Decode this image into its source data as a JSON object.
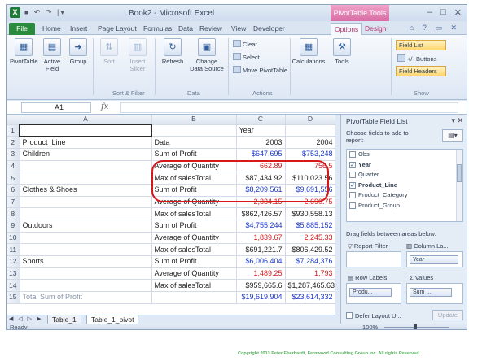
{
  "window": {
    "title": "Book2 - Microsoft Excel",
    "context_title": "PivotTable Tools",
    "app_icon": "excel-icon",
    "qat": "■ ↶ ↷ |▾",
    "controls": [
      "–",
      "□",
      "✕"
    ]
  },
  "tabs": [
    "File",
    "Home",
    "Insert",
    "Page Layout",
    "Formulas",
    "Data",
    "Review",
    "View",
    "Developer",
    "Options",
    "Design"
  ],
  "help_icons": "⌂ ? ▭ ✕",
  "ribbon": {
    "pivottable": "PivotTable",
    "active_field": "Active Field",
    "group": "Group",
    "sort": "Sort",
    "insert_slicer": "Insert Slicer",
    "refresh": "Refresh",
    "change_data_source": "Change Data Source",
    "clear": "Clear",
    "select": "Select",
    "move_pivottable": "Move PivotTable",
    "calculations": "Calculations",
    "tools": "Tools",
    "field_list": "Field List",
    "buttons": "+/- Buttons",
    "field_headers": "Field Headers",
    "groups": [
      "Sort & Filter",
      "Data",
      "Actions",
      "Show"
    ]
  },
  "formula_bar": {
    "cell_ref": "A1",
    "fx": "fx",
    "value": ""
  },
  "sheet": {
    "col_headers": [
      "A",
      "B",
      "C",
      "D"
    ],
    "rows": [
      {
        "rn": "1",
        "a": "",
        "b": "",
        "c": "Year",
        "d": ""
      },
      {
        "rn": "2",
        "a": "Product_Line",
        "b": "Data",
        "c": "2003",
        "d": "2004"
      },
      {
        "rn": "3",
        "a": "Children",
        "b": "Sum of Profit",
        "c": "$647,695",
        "d": "$753,248"
      },
      {
        "rn": "4",
        "a": "",
        "b": "Average of Quantity",
        "c": "662.89",
        "d": "756.5"
      },
      {
        "rn": "5",
        "a": "",
        "b": "Max of salesTotal",
        "c": "$87,434.92",
        "d": "$110,023.56"
      },
      {
        "rn": "6",
        "a": "Clothes & Shoes",
        "b": "Sum of Profit",
        "c": "$8,209,561",
        "d": "$9,691,556"
      },
      {
        "rn": "7",
        "a": "",
        "b": "Average of Quantity",
        "c": "2,334.15",
        "d": "2,690.75"
      },
      {
        "rn": "8",
        "a": "",
        "b": "Max of salesTotal",
        "c": "$862,426.57",
        "d": "$930,558.13"
      },
      {
        "rn": "9",
        "a": "Outdoors",
        "b": "Sum of Profit",
        "c": "$4,755,244",
        "d": "$5,885,152"
      },
      {
        "rn": "10",
        "a": "",
        "b": "Average of Quantity",
        "c": "1,839.67",
        "d": "2,245.33"
      },
      {
        "rn": "11",
        "a": "",
        "b": "Max of salesTotal",
        "c": "$691,221.7",
        "d": "$806,429.52"
      },
      {
        "rn": "12",
        "a": "Sports",
        "b": "Sum of Profit",
        "c": "$6,006,404",
        "d": "$7,284,376"
      },
      {
        "rn": "13",
        "a": "",
        "b": "Average of Quantity",
        "c": "1,489.25",
        "d": "1,793"
      },
      {
        "rn": "14",
        "a": "",
        "b": "Max of salesTotal",
        "c": "$959,665.6",
        "d": "$1,287,465.63"
      },
      {
        "rn": "15",
        "a": "Total Sum of Profit",
        "b": "",
        "c": "$19,619,904",
        "d": "$23,614,332"
      }
    ],
    "tabs": [
      "Table_1",
      "Table_1_pivot"
    ],
    "nav_arrows": "◀ ◁ ▷ ▶"
  },
  "status": {
    "ready": "Ready",
    "zoom": "100%"
  },
  "field_list": {
    "title": "PivotTable Field List",
    "subtitle": "Choose fields to add to report:",
    "fields": [
      {
        "name": "Obs",
        "checked": false,
        "bold": false
      },
      {
        "name": "Year",
        "checked": true,
        "bold": true
      },
      {
        "name": "Quarter",
        "checked": false,
        "bold": false
      },
      {
        "name": "Product_Line",
        "checked": true,
        "bold": true
      },
      {
        "name": "Product_Category",
        "checked": false,
        "bold": false
      },
      {
        "name": "Product_Group",
        "checked": false,
        "bold": false
      }
    ],
    "drag_label": "Drag fields between areas below:",
    "report_filter": "Report Filter",
    "column_labels": "Column La...",
    "column_chip": "Year",
    "row_labels": "Row Labels",
    "values": "Values",
    "row_chip": "Produ...",
    "values_chip": "Sum ...",
    "defer": "Defer Layout U...",
    "update": "Update"
  },
  "copyright": "Copyright 2013 Peter Eberhardt, Fernwood Consulting Group Inc. All rights Reserved."
}
